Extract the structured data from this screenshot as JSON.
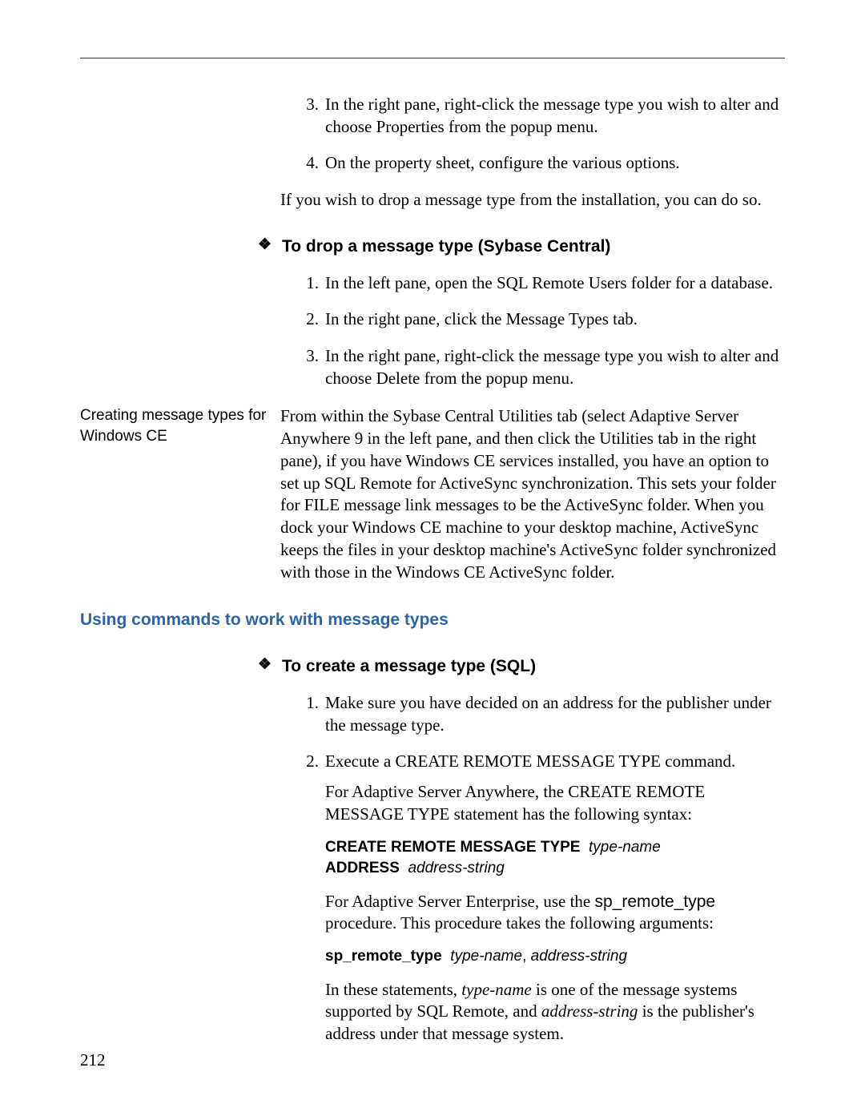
{
  "page_number": "212",
  "steps_top": {
    "s3": "In the right pane, right-click the message type you wish to alter and choose Properties from the popup menu.",
    "s4": "On the property sheet, configure the various options."
  },
  "drop_intro": "If you wish to drop a message type from the installation, you can do so.",
  "proc1": {
    "title": "To drop a message type (Sybase Central)",
    "s1": "In the left pane, open the SQL Remote Users folder for a database.",
    "s2": "In the right pane, click the Message Types tab.",
    "s3": "In the right pane, right-click the message type you wish to alter and choose Delete from the popup menu."
  },
  "side_label": "Creating message types for Windows CE",
  "side_para": "From within the Sybase Central Utilities tab (select Adaptive Server Anywhere 9 in the left pane, and then click the Utilities tab in the right pane), if you have Windows CE services installed, you have an option to set up SQL Remote for ActiveSync synchronization. This sets your folder for FILE message link messages to be the ActiveSync folder. When you dock your Windows CE machine to your desktop machine, ActiveSync keeps the files in your desktop machine's ActiveSync folder synchronized with those in the Windows CE ActiveSync folder.",
  "section_title": "Using commands to work with message types",
  "proc2": {
    "title": "To create a message type (SQL)",
    "s1": "Make sure you have decided on an address for the publisher under the message type.",
    "s2": "Execute a CREATE REMOTE MESSAGE TYPE command.",
    "p_asa": "For Adaptive Server Anywhere, the CREATE REMOTE MESSAGE TYPE statement has the following syntax:",
    "syntax1_a": "CREATE REMOTE MESSAGE TYPE",
    "syntax1_b": "type-name",
    "syntax1_c": "ADDRESS",
    "syntax1_d": "address-string",
    "p_ase_a": "For Adaptive Server Enterprise, use the ",
    "p_ase_b": "sp_remote_type",
    "p_ase_c": " procedure. This procedure takes the following arguments:",
    "syntax2_a": "sp_remote_type",
    "syntax2_b": "type-name",
    "syntax2_c": "address-string",
    "p_end_a": "In these statements, ",
    "p_end_b": "type-name",
    "p_end_c": " is one of the message systems supported by SQL Remote, and ",
    "p_end_d": "address-string",
    "p_end_e": " is the publisher's address under that message system."
  }
}
